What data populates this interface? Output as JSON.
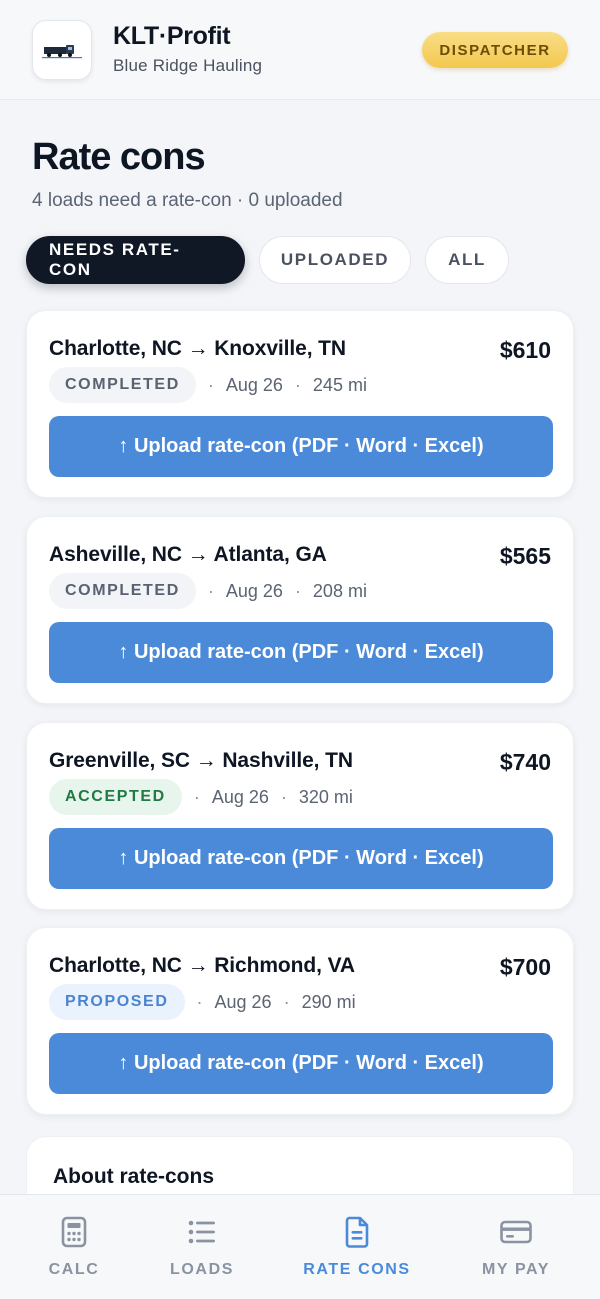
{
  "header": {
    "brand_title": "KLT·Profit",
    "brand_sub": "Blue Ridge Hauling",
    "role": "DISPATCHER"
  },
  "page": {
    "title": "Rate cons",
    "subtitle": "4 loads need a rate-con · 0 uploaded"
  },
  "tabs": [
    {
      "label": "NEEDS RATE-CON",
      "active": true
    },
    {
      "label": "UPLOADED",
      "active": false
    },
    {
      "label": "ALL",
      "active": false
    }
  ],
  "loads": [
    {
      "route": "Charlotte, NC → Knoxville, TN",
      "price": "$610",
      "status": "COMPLETED",
      "date": "Aug 26",
      "distance": "245 mi",
      "button": "↑ Upload rate-con (PDF · Word · Excel)"
    },
    {
      "route": "Asheville, NC → Atlanta, GA",
      "price": "$565",
      "status": "COMPLETED",
      "date": "Aug 26",
      "distance": "208 mi",
      "button": "↑ Upload rate-con (PDF · Word · Excel)"
    },
    {
      "route": "Greenville, SC → Nashville, TN",
      "price": "$740",
      "status": "ACCEPTED",
      "date": "Aug 26",
      "distance": "320 mi",
      "button": "↑ Upload rate-con (PDF · Word · Excel)"
    },
    {
      "route": "Charlotte, NC → Richmond, VA",
      "price": "$700",
      "status": "PROPOSED",
      "date": "Aug 26",
      "distance": "290 mi",
      "button": "↑ Upload rate-con (PDF · Word · Excel)"
    }
  ],
  "about": {
    "title": "About rate-cons"
  },
  "nav": [
    {
      "label": "CALC",
      "icon": "calculator-icon",
      "active": false
    },
    {
      "label": "LOADS",
      "icon": "list-icon",
      "active": false
    },
    {
      "label": "RATE CONS",
      "icon": "document-icon",
      "active": true
    },
    {
      "label": "MY PAY",
      "icon": "credit-card-icon",
      "active": false
    }
  ],
  "colors": {
    "accent": "#4b8ad9",
    "dark": "#101826",
    "badge_gold": "#f3c84f"
  }
}
